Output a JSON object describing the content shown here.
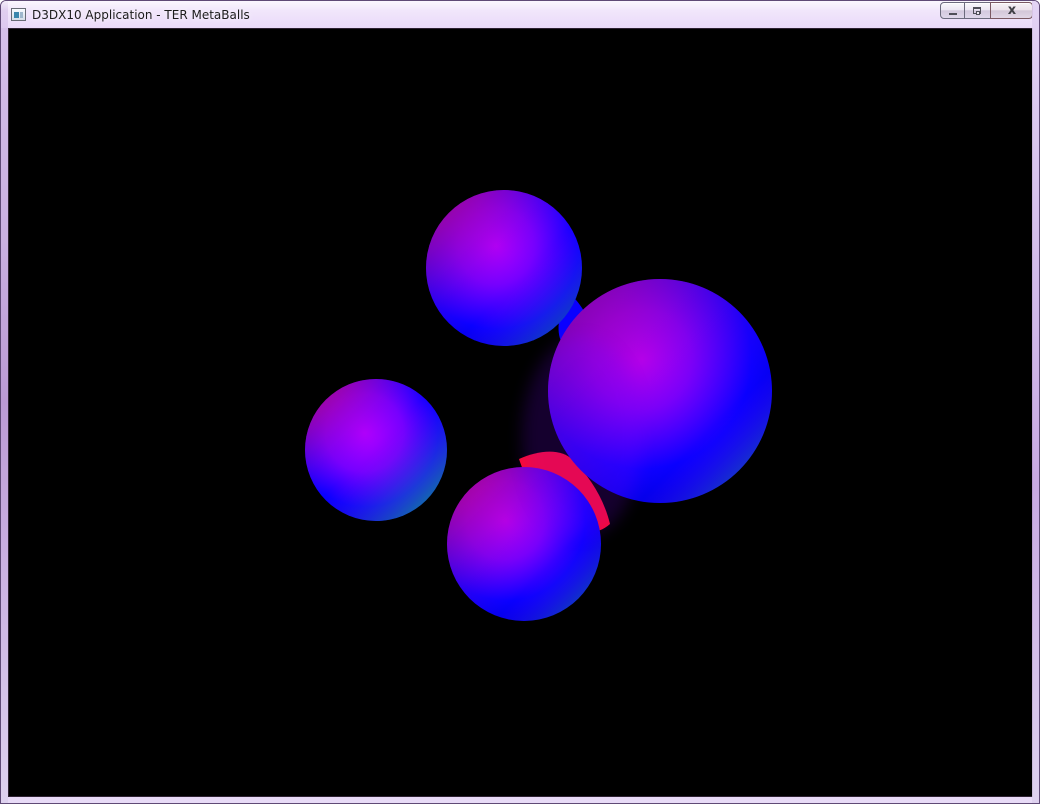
{
  "window": {
    "title": "D3DX10 Application - TER MetaBalls",
    "controls": {
      "minimize_icon": "minimize-icon",
      "maximize_icon": "maximize-icon",
      "close_icon": "close-icon",
      "close_glyph": "x"
    }
  },
  "scene": {
    "background_color": "#000000",
    "colors": {
      "red": "#ff0a2e",
      "magenta": "#b400ff",
      "violet": "#7600ff",
      "blue": "#0a00ff",
      "deep_blue": "#0000d8",
      "green": "#00ff55"
    }
  }
}
